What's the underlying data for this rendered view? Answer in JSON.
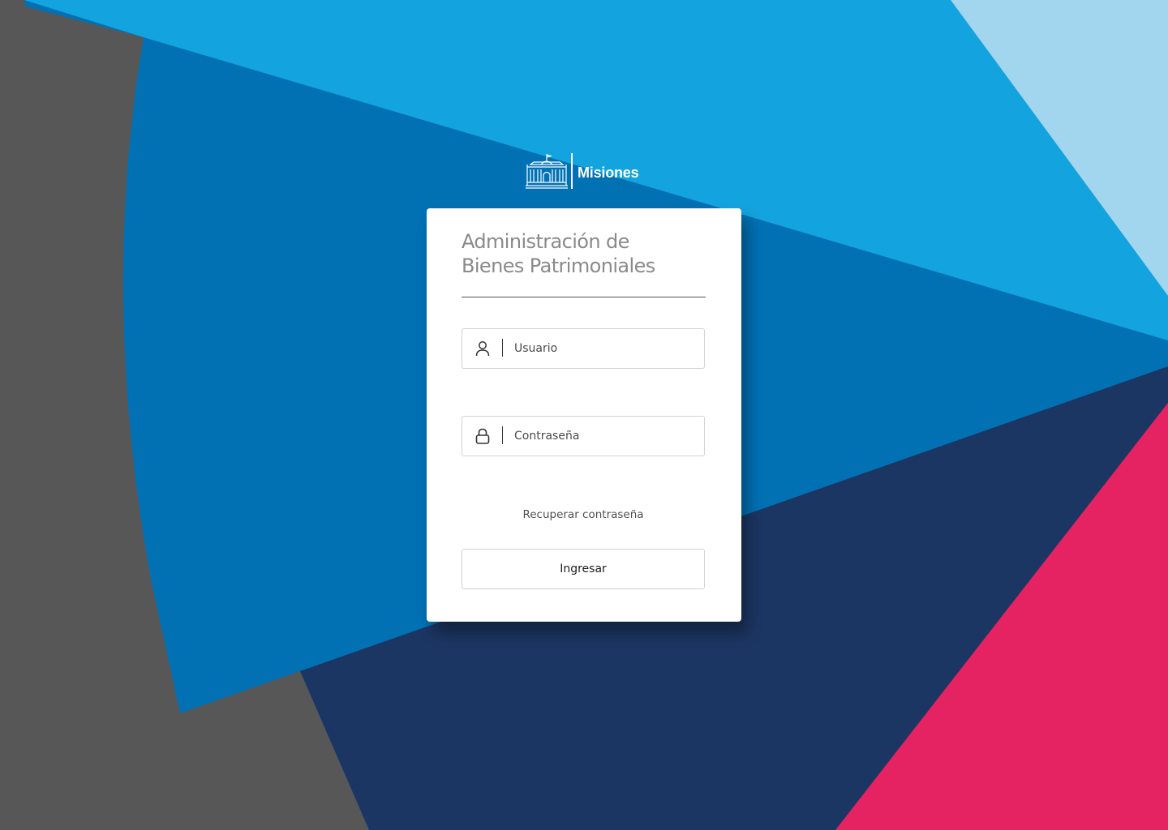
{
  "brand": {
    "name": "Misiones",
    "logo_icon": "government-building-icon"
  },
  "login": {
    "title_line1": "Administración de",
    "title_line2": "Bienes Patrimoniales",
    "username": {
      "icon": "user-icon",
      "placeholder": "Usuario",
      "value": ""
    },
    "password": {
      "icon": "lock-icon",
      "placeholder": "Contraseña",
      "value": ""
    },
    "recover_link": "Recuperar contraseña",
    "submit_label": "Ingresar"
  },
  "colors": {
    "light_blue": "#13a3df",
    "mid_blue": "#0271b4",
    "pale_blue": "#a1d6ee",
    "navy": "#1c3663",
    "magenta": "#e52262",
    "gray": "#575757",
    "card": "#ffffff"
  }
}
